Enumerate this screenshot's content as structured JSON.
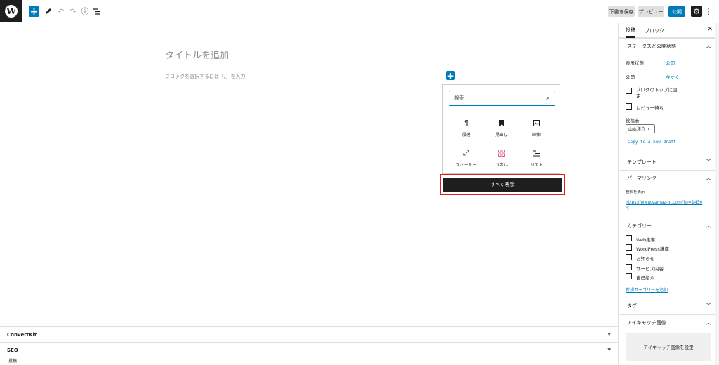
{
  "toolbar": {
    "draft_label": "下書き保存",
    "preview_label": "プレビュー",
    "publish_label": "公開"
  },
  "editor": {
    "title_placeholder": "タイトルを追加",
    "block_placeholder": "ブロックを選択するには「/」を入力"
  },
  "inserter": {
    "search_placeholder": "検索",
    "items": [
      {
        "label": "段落",
        "icon": "paragraph-icon"
      },
      {
        "label": "見出し",
        "icon": "bookmark-icon"
      },
      {
        "label": "画像",
        "icon": "image-icon"
      },
      {
        "label": "スペーサー",
        "icon": "resize-icon"
      },
      {
        "label": "パネル",
        "icon": "grid-icon"
      },
      {
        "label": "リスト",
        "icon": "list-icon"
      }
    ],
    "show_all_label": "すべて表示"
  },
  "metaboxes": [
    {
      "label": "ConvertKit"
    },
    {
      "label": "SEO"
    }
  ],
  "footer": {
    "breadcrumb": "投稿"
  },
  "sidebar": {
    "tabs": [
      "投稿",
      "ブロック"
    ],
    "status_panel": {
      "title": "ステータスと公開状態",
      "visibility_label": "表示状態",
      "visibility_value": "公開",
      "publish_label": "公開",
      "publish_value": "今すぐ",
      "sticky_label_1": "ブログのトップに固",
      "sticky_label_2": "定",
      "pending_label": "レビュー待ち",
      "author_label": "投稿者",
      "author_value": "山本洋介",
      "copy_draft": "Copy to a new draft"
    },
    "template_panel": {
      "title": "テンプレート"
    },
    "permalink_panel": {
      "title": "パーマリンク",
      "view_label": "投稿を表示",
      "url": "https://www.yamaz-hi.com/?p=1430"
    },
    "category_panel": {
      "title": "カテゴリー",
      "items": [
        "Web集客",
        "WordPress講座",
        "お知らせ",
        "サービス内容",
        "自己紹介"
      ],
      "add_new": "新規カテゴリーを追加"
    },
    "tag_panel": {
      "title": "タグ"
    },
    "featured_panel": {
      "title": "アイキャッチ画像",
      "set_label": "アイキャッチ画像を設定"
    }
  }
}
